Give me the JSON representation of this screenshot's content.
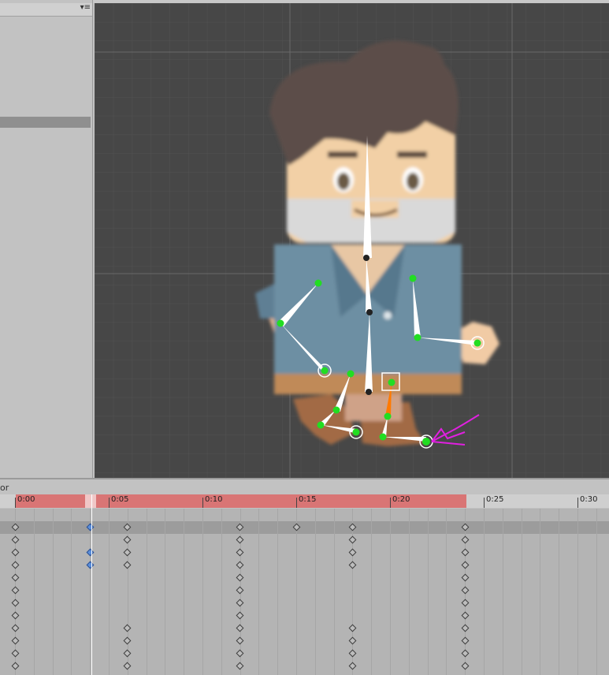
{
  "left_panel": {
    "menu_glyph": "▾≡"
  },
  "bottom_panel": {
    "label": "or"
  },
  "timeline": {
    "ticks": [
      "0:00",
      "0:05",
      "0:10",
      "0:15",
      "0:20",
      "0:25",
      "0:30"
    ],
    "playhead_frame": "0:04"
  },
  "scene": {
    "colors": {
      "viewport_bg": "#474747",
      "bone": "#ffffff",
      "joint": "#22dd22",
      "selected_bone": "#ff7a00",
      "gizmo": "#e020e0"
    }
  },
  "keyframes": {
    "rows": [
      {
        "row": 0,
        "frames": [
          0,
          4,
          6,
          12,
          15,
          18,
          24
        ],
        "selected": [
          4
        ]
      },
      {
        "row": 1,
        "frames": [
          0,
          6,
          12,
          18,
          24
        ],
        "selected": []
      },
      {
        "row": 2,
        "frames": [
          0,
          4,
          6,
          12,
          18,
          24
        ],
        "selected": [
          4
        ]
      },
      {
        "row": 3,
        "frames": [
          0,
          4,
          6,
          12,
          18,
          24
        ],
        "selected": [
          4
        ]
      },
      {
        "row": 4,
        "frames": [
          0,
          12,
          24
        ],
        "selected": []
      },
      {
        "row": 5,
        "frames": [
          0,
          12,
          24
        ],
        "selected": []
      },
      {
        "row": 6,
        "frames": [
          0,
          12,
          24
        ],
        "selected": []
      },
      {
        "row": 7,
        "frames": [
          0,
          12,
          24
        ],
        "selected": []
      },
      {
        "row": 8,
        "frames": [
          0,
          6,
          12,
          18,
          24
        ],
        "selected": []
      },
      {
        "row": 9,
        "frames": [
          0,
          6,
          12,
          18,
          24
        ],
        "selected": []
      },
      {
        "row": 10,
        "frames": [
          0,
          6,
          12,
          18,
          24
        ],
        "selected": []
      },
      {
        "row": 11,
        "frames": [
          0,
          6,
          12,
          18,
          24
        ],
        "selected": []
      }
    ]
  }
}
